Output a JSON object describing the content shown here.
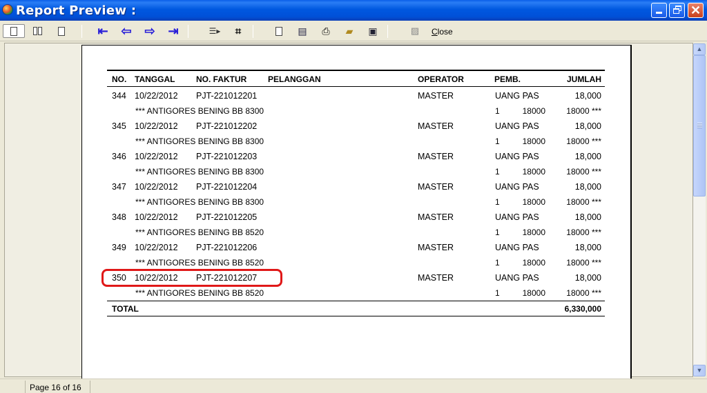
{
  "window": {
    "title": "Report Preview :"
  },
  "toolbar": {
    "close_label": "Close"
  },
  "report": {
    "columns": [
      "NO.",
      "TANGGAL",
      "NO. FAKTUR",
      "PELANGGAN",
      "OPERATOR",
      "PEMB.",
      "JUMLAH"
    ],
    "rows": [
      {
        "no": "344",
        "date": "10/22/2012",
        "invoice": "PJT-221012201",
        "operator": "MASTER",
        "payment": "UANG PAS",
        "amount": "18,000",
        "item": "*** ANTIGORES BENING BB 8300",
        "qty": "1",
        "price": "18000",
        "subtotal": "18000 ***"
      },
      {
        "no": "345",
        "date": "10/22/2012",
        "invoice": "PJT-221012202",
        "operator": "MASTER",
        "payment": "UANG PAS",
        "amount": "18,000",
        "item": "*** ANTIGORES BENING BB 8300",
        "qty": "1",
        "price": "18000",
        "subtotal": "18000 ***"
      },
      {
        "no": "346",
        "date": "10/22/2012",
        "invoice": "PJT-221012203",
        "operator": "MASTER",
        "payment": "UANG PAS",
        "amount": "18,000",
        "item": "*** ANTIGORES BENING BB 8300",
        "qty": "1",
        "price": "18000",
        "subtotal": "18000 ***"
      },
      {
        "no": "347",
        "date": "10/22/2012",
        "invoice": "PJT-221012204",
        "operator": "MASTER",
        "payment": "UANG PAS",
        "amount": "18,000",
        "item": "*** ANTIGORES BENING BB 8300",
        "qty": "1",
        "price": "18000",
        "subtotal": "18000 ***"
      },
      {
        "no": "348",
        "date": "10/22/2012",
        "invoice": "PJT-221012205",
        "operator": "MASTER",
        "payment": "UANG PAS",
        "amount": "18,000",
        "item": "*** ANTIGORES BENING BB 8520",
        "qty": "1",
        "price": "18000",
        "subtotal": "18000 ***"
      },
      {
        "no": "349",
        "date": "10/22/2012",
        "invoice": "PJT-221012206",
        "operator": "MASTER",
        "payment": "UANG PAS",
        "amount": "18,000",
        "item": "*** ANTIGORES BENING BB 8520",
        "qty": "1",
        "price": "18000",
        "subtotal": "18000 ***"
      },
      {
        "no": "350",
        "date": "10/22/2012",
        "invoice": "PJT-221012207",
        "operator": "MASTER",
        "payment": "UANG PAS",
        "amount": "18,000",
        "item": "*** ANTIGORES BENING BB 8520",
        "qty": "1",
        "price": "18000",
        "subtotal": "18000 ***"
      }
    ],
    "total_label": "TOTAL",
    "total_value": "6,330,000"
  },
  "status": {
    "page_text": "Page 16 of 16"
  },
  "icons": [
    "page-icon",
    "two-page-icon",
    "first-page-icon",
    "previous-page-icon",
    "next-page-icon",
    "last-page-icon",
    "goto-page-icon",
    "find-icon",
    "copy-icon",
    "setup-icon",
    "print-icon",
    "open-icon",
    "save-icon",
    "export-icon"
  ]
}
